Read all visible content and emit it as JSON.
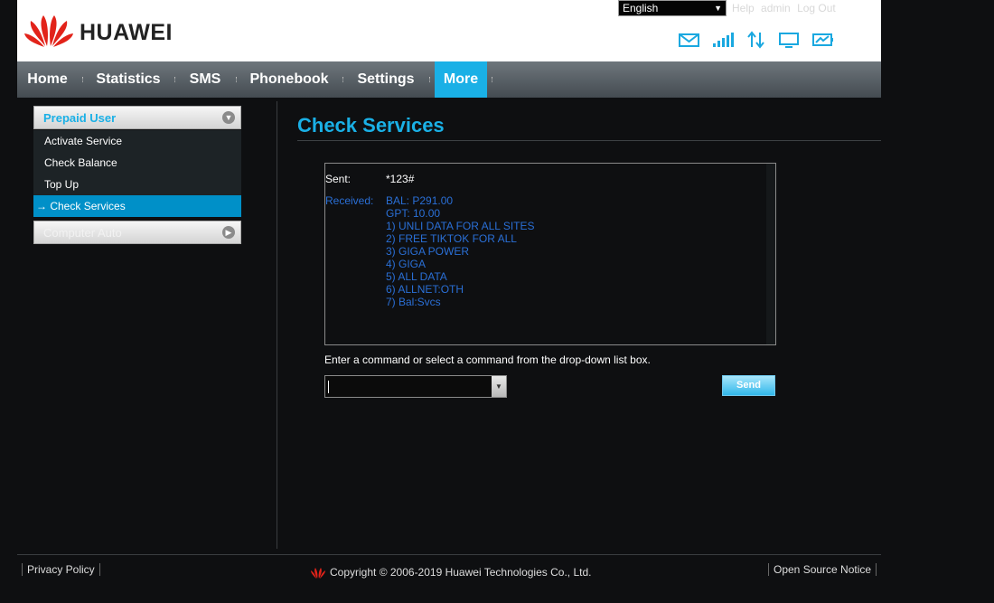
{
  "header": {
    "brand": "HUAWEI",
    "language": "English",
    "top_links": [
      "Help",
      "admin",
      "Log Out"
    ]
  },
  "nav": {
    "items": [
      "Home",
      "Statistics",
      "SMS",
      "Phonebook",
      "Settings",
      "More"
    ],
    "active": "More"
  },
  "sidebar": {
    "group1": "Prepaid User",
    "group2": "Computer Auto",
    "items": [
      "Activate Service",
      "Check Balance",
      "Top Up",
      "Check Services"
    ],
    "active_prefix": "→",
    "active": "Check Services"
  },
  "main": {
    "title": "Check Services",
    "sent_label": "Sent:",
    "sent_value": "*123#",
    "received_label": "Received:",
    "received_lines": [
      "BAL: P291.00",
      "GPT: 10.00",
      "1) UNLI DATA FOR ALL SITES",
      "2) FREE TIKTOK FOR ALL",
      "3) GIGA POWER",
      "4) GIGA",
      "5) ALL DATA",
      "6) ALLNET:OTH",
      "7) Bal:Svcs"
    ],
    "hint": "Enter a command or select a command from the drop-down list box.",
    "command_value": "",
    "send_label": "Send"
  },
  "footer": {
    "privacy": "Privacy Policy",
    "copyright": "Copyright © 2006-2019 Huawei Technologies Co., Ltd.",
    "open_source": "Open Source Notice"
  },
  "colors": {
    "accent": "#1ab0e6",
    "received_text": "#2a6fd6",
    "background": "#0e0f11",
    "brand_red": "#e2231a"
  },
  "icons": [
    "huawei-logo-icon",
    "mail-icon",
    "signal-icon",
    "data-arrows-icon",
    "computer-icon",
    "battery-icon",
    "dropdown-arrow-icon",
    "collapse-icon",
    "expand-icon"
  ]
}
